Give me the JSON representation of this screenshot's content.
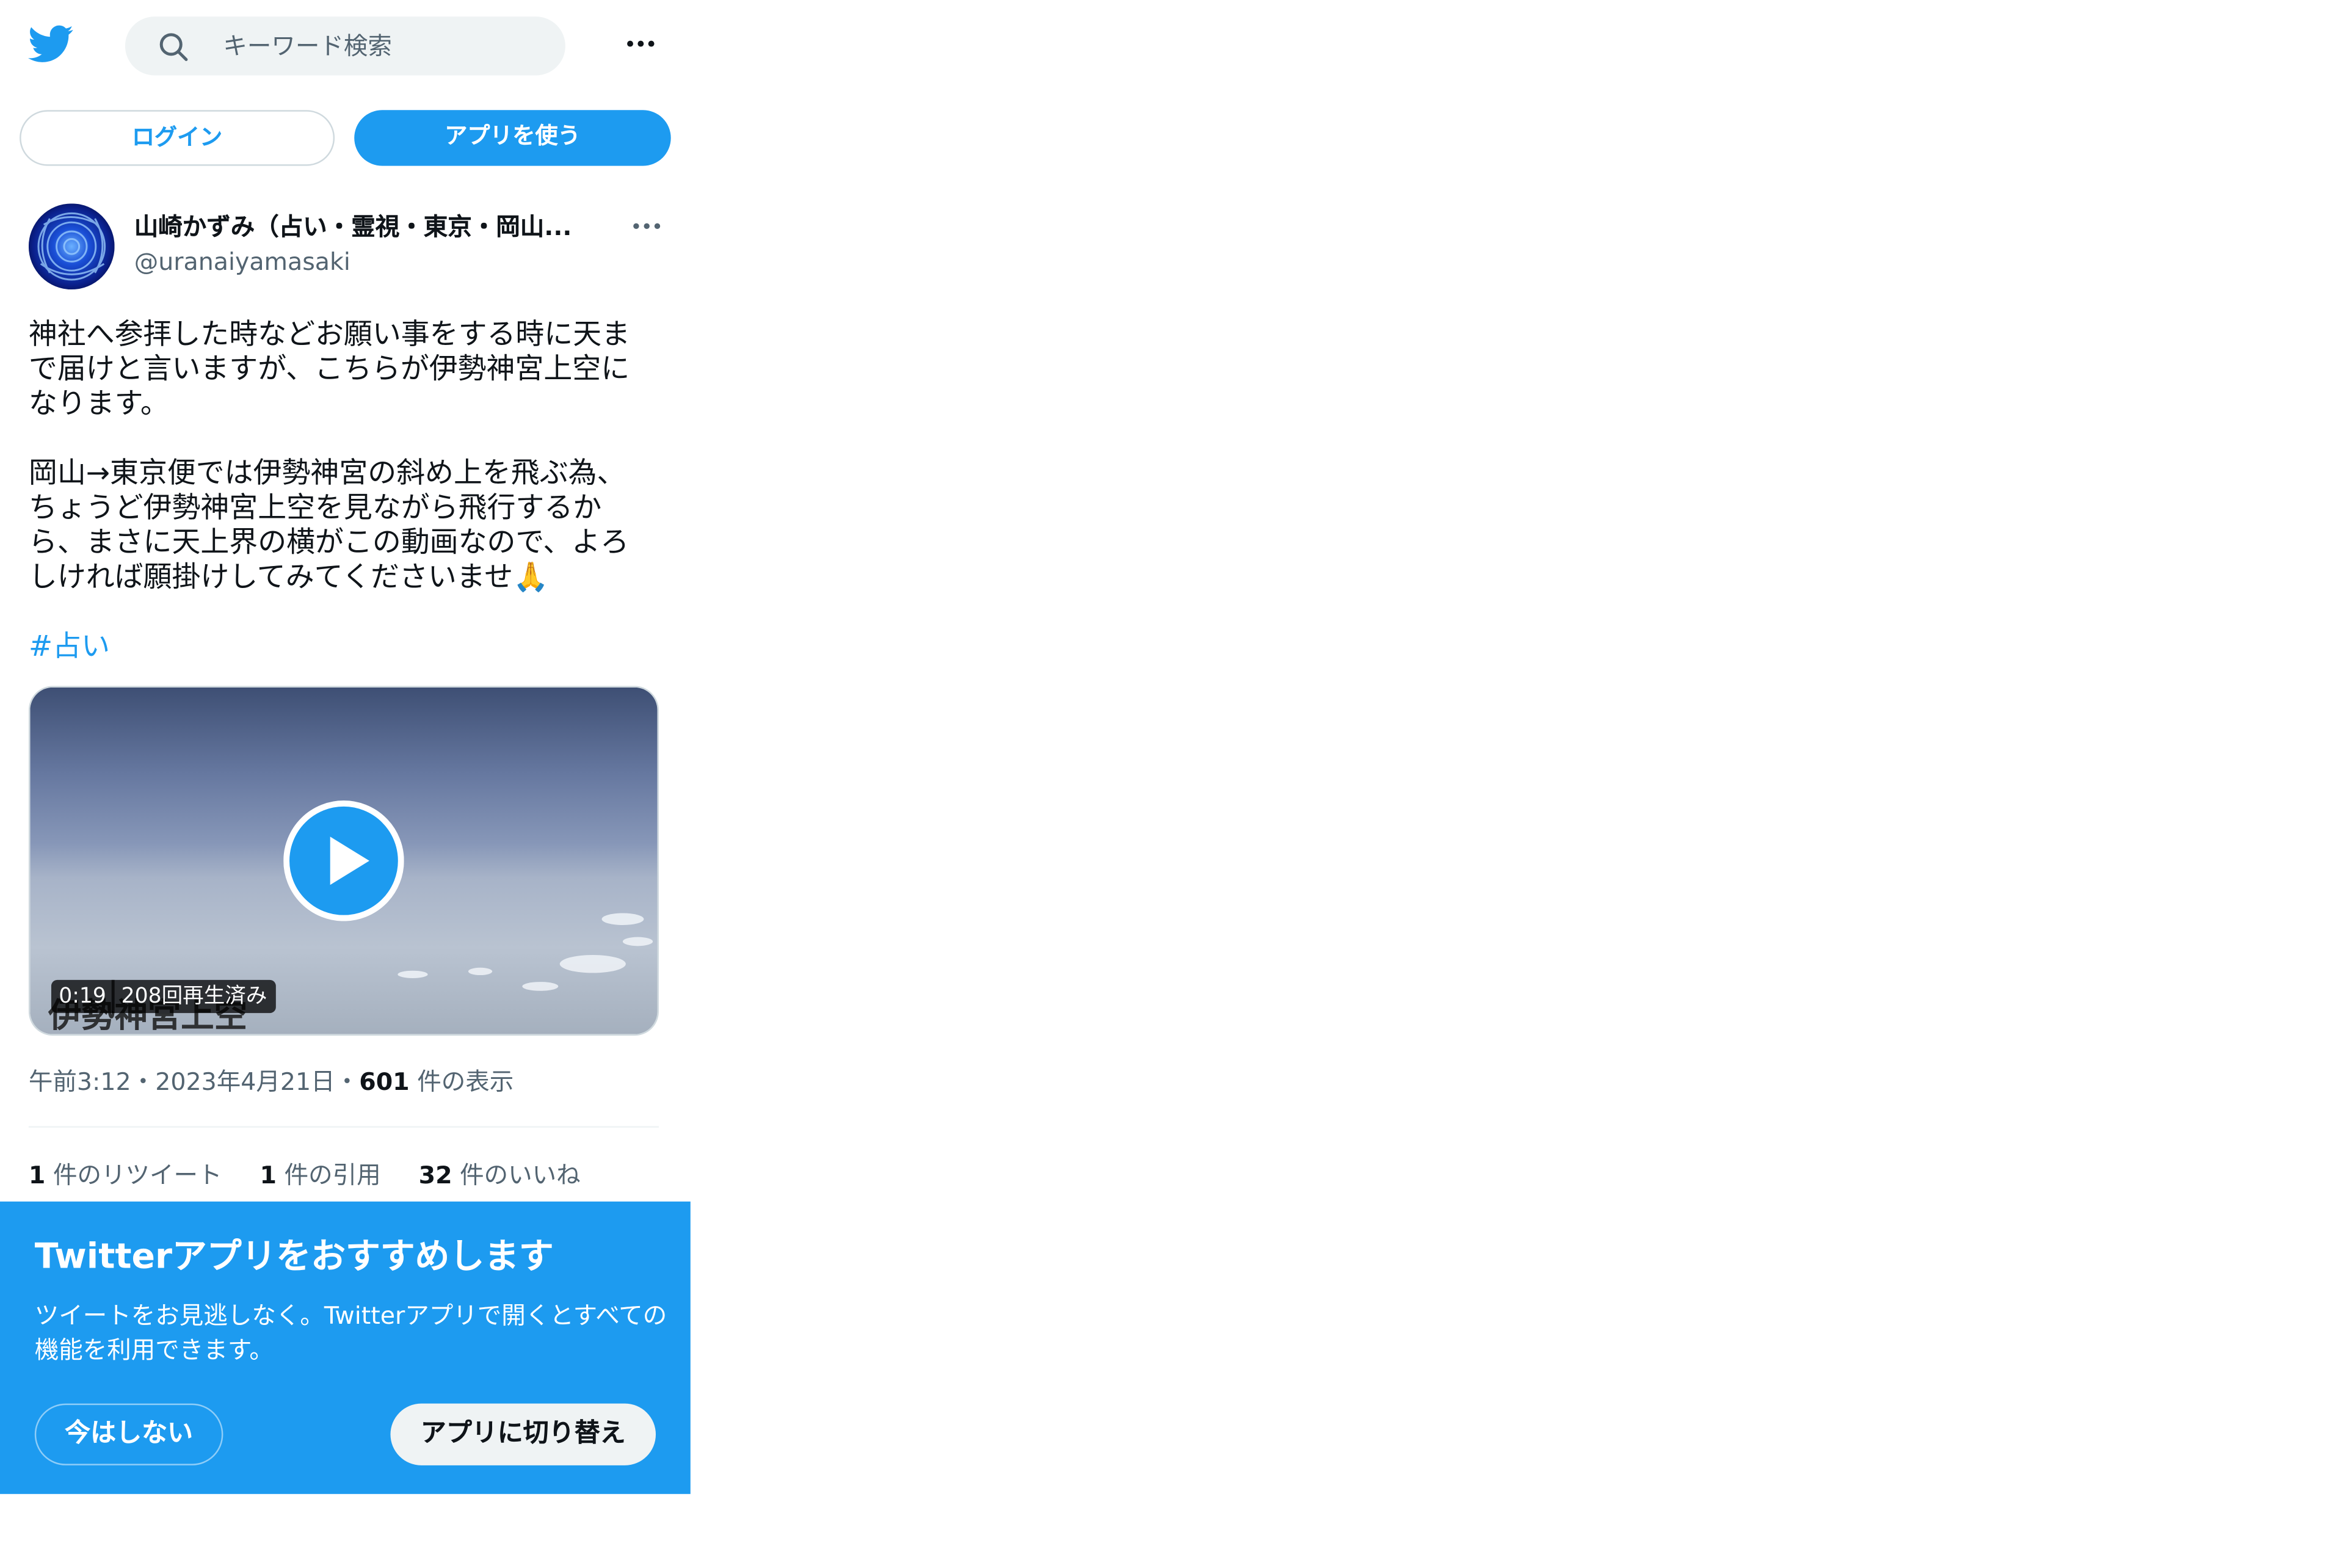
{
  "header": {
    "logo_icon": "twitter-bird-icon",
    "search_placeholder": "キーワード検索",
    "more_icon": "more-horizontal-icon"
  },
  "auth": {
    "login_label": "ログイン",
    "use_app_label": "アプリを使う"
  },
  "tweet": {
    "display_name": "山崎かずみ（占い・霊視・東京・岡山・全国出張）",
    "display_name_shown": "山崎かずみ（占い・霊視・東京・岡山...",
    "handle": "@uranaiyamasaki",
    "lines": [
      "神社へ参拝した時などお願い事をする時に天ま",
      "で届けと言いますが、こちらが伊勢神宮上空に",
      "なります。",
      "岡山→東京便では伊勢神宮の斜め上を飛ぶ為、",
      "ちょうど伊勢神宮上空を見ながら飛行するか",
      "ら、まさに天上界の横がこの動画なので、よろ",
      "しければ願掛けしてみてくださいませ🙏"
    ],
    "hashtag": "#占い",
    "video": {
      "overlay_text": "伊勢神宮上空",
      "duration": "0:19",
      "views": "208回再生済み"
    },
    "time": "午前3:12",
    "date": "2023年4月21日",
    "view_count": "601",
    "view_label": "件の表示",
    "dot": "・",
    "stats": {
      "retweets": "1",
      "retweets_label": "件のリツイート",
      "quotes": "1",
      "quotes_label": "件の引用",
      "likes": "32",
      "likes_label": "件のいいね"
    }
  },
  "promo": {
    "title": "Twitterアプリをおすすめします",
    "text": "ツイートをお見逃しなく。Twitterアプリで開くとすべての機能を利用できます。",
    "not_now": "今はしない",
    "switch": "アプリに切り替え"
  },
  "colors": {
    "brand": "#1d9bf0",
    "text": "#0f1419",
    "muted": "#536471"
  }
}
